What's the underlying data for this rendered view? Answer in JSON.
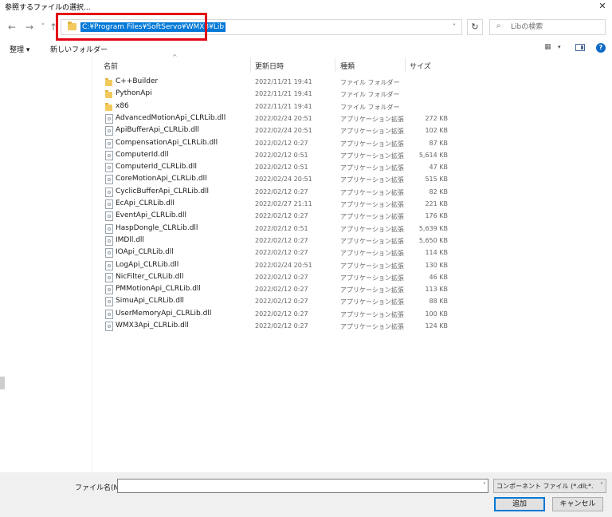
{
  "window": {
    "title": "参照するファイルの選択...",
    "close_glyph": "✕"
  },
  "nav": {
    "back": "←",
    "forward": "→",
    "recent": "˅",
    "up": "↑"
  },
  "address": {
    "path": "C:¥Program Files¥SoftServo¥WMX3¥Lib",
    "dropdown": "˅",
    "refresh": "↻"
  },
  "search": {
    "icon": "⌕",
    "placeholder": "Libの検索"
  },
  "toolbar": {
    "organize": "整理 ▾",
    "new_folder": "新しいフォルダー",
    "view_glyph": "▦",
    "view_dd": "▾",
    "help": "?"
  },
  "columns": {
    "name": "名前",
    "date": "更新日時",
    "type": "種類",
    "size": "サイズ",
    "sort_glyph": "^"
  },
  "files": [
    {
      "name": "C++Builder",
      "date": "2022/11/21 19:41",
      "type": "ファイル フォルダー",
      "size": "",
      "kind": "folder"
    },
    {
      "name": "PythonApi",
      "date": "2022/11/21 19:41",
      "type": "ファイル フォルダー",
      "size": "",
      "kind": "folder"
    },
    {
      "name": "x86",
      "date": "2022/11/21 19:41",
      "type": "ファイル フォルダー",
      "size": "",
      "kind": "folder"
    },
    {
      "name": "AdvancedMotionApi_CLRLib.dll",
      "date": "2022/02/24 20:51",
      "type": "アプリケーション拡張",
      "size": "272 KB",
      "kind": "file"
    },
    {
      "name": "ApiBufferApi_CLRLib.dll",
      "date": "2022/02/24 20:51",
      "type": "アプリケーション拡張",
      "size": "102 KB",
      "kind": "file"
    },
    {
      "name": "CompensationApi_CLRLib.dll",
      "date": "2022/02/12 0:27",
      "type": "アプリケーション拡張",
      "size": "87 KB",
      "kind": "file"
    },
    {
      "name": "ComputerId.dll",
      "date": "2022/02/12 0:51",
      "type": "アプリケーション拡張",
      "size": "5,614 KB",
      "kind": "file"
    },
    {
      "name": "ComputerId_CLRLib.dll",
      "date": "2022/02/12 0:51",
      "type": "アプリケーション拡張",
      "size": "47 KB",
      "kind": "file"
    },
    {
      "name": "CoreMotionApi_CLRLib.dll",
      "date": "2022/02/24 20:51",
      "type": "アプリケーション拡張",
      "size": "515 KB",
      "kind": "file"
    },
    {
      "name": "CyclicBufferApi_CLRLib.dll",
      "date": "2022/02/12 0:27",
      "type": "アプリケーション拡張",
      "size": "82 KB",
      "kind": "file"
    },
    {
      "name": "EcApi_CLRLib.dll",
      "date": "2022/02/27 21:11",
      "type": "アプリケーション拡張",
      "size": "221 KB",
      "kind": "file"
    },
    {
      "name": "EventApi_CLRLib.dll",
      "date": "2022/02/12 0:27",
      "type": "アプリケーション拡張",
      "size": "176 KB",
      "kind": "file"
    },
    {
      "name": "HaspDongle_CLRLib.dll",
      "date": "2022/02/12 0:51",
      "type": "アプリケーション拡張",
      "size": "5,639 KB",
      "kind": "file"
    },
    {
      "name": "IMDll.dll",
      "date": "2022/02/12 0:27",
      "type": "アプリケーション拡張",
      "size": "5,650 KB",
      "kind": "file"
    },
    {
      "name": "IOApi_CLRLib.dll",
      "date": "2022/02/12 0:27",
      "type": "アプリケーション拡張",
      "size": "114 KB",
      "kind": "file"
    },
    {
      "name": "LogApi_CLRLib.dll",
      "date": "2022/02/24 20:51",
      "type": "アプリケーション拡張",
      "size": "130 KB",
      "kind": "file"
    },
    {
      "name": "NicFilter_CLRLib.dll",
      "date": "2022/02/12 0:27",
      "type": "アプリケーション拡張",
      "size": "46 KB",
      "kind": "file"
    },
    {
      "name": "PMMotionApi_CLRLib.dll",
      "date": "2022/02/12 0:27",
      "type": "アプリケーション拡張",
      "size": "113 KB",
      "kind": "file"
    },
    {
      "name": "SimuApi_CLRLib.dll",
      "date": "2022/02/12 0:27",
      "type": "アプリケーション拡張",
      "size": "88 KB",
      "kind": "file"
    },
    {
      "name": "UserMemoryApi_CLRLib.dll",
      "date": "2022/02/12 0:27",
      "type": "アプリケーション拡張",
      "size": "100 KB",
      "kind": "file"
    },
    {
      "name": "WMX3Api_CLRLib.dll",
      "date": "2022/02/12 0:27",
      "type": "アプリケーション拡張",
      "size": "124 KB",
      "kind": "file"
    }
  ],
  "footer": {
    "filename_label": "ファイル名(N):",
    "filename_value": "",
    "filename_dd": "˅",
    "filter": "コンポーネント ファイル (*.dll;*.tlb;*.",
    "filter_dd": "˅",
    "open": "追加",
    "cancel": "キャンセル"
  }
}
